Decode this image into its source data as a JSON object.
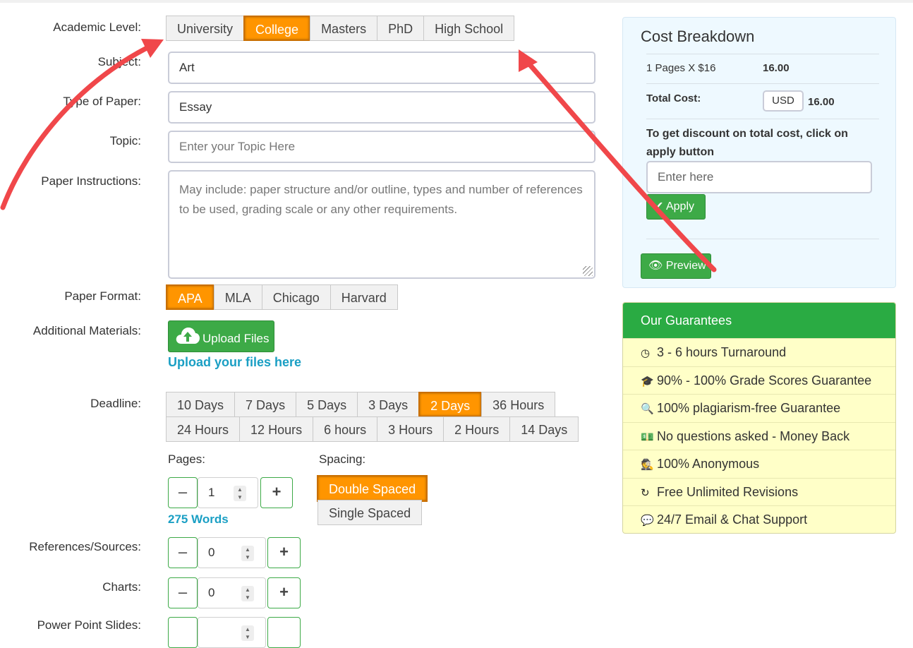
{
  "labels": {
    "academic_level": "Academic Level:",
    "subject": "Subject:",
    "type_of_paper": "Type of Paper:",
    "topic": "Topic:",
    "paper_instructions": "Paper Instructions:",
    "paper_format": "Paper Format:",
    "additional_materials": "Additional Materials:",
    "deadline": "Deadline:",
    "references": "References/Sources:",
    "charts": "Charts:",
    "power_point": "Power Point Slides:"
  },
  "academic_levels": [
    "University",
    "College",
    "Masters",
    "PhD",
    "High School"
  ],
  "academic_level_selected": "College",
  "subject_value": "Art",
  "paper_type_value": "Essay",
  "topic_placeholder": "Enter your Topic Here",
  "instructions_placeholder": "May include: paper structure and/or outline, types and number of references to be used, grading scale or any other requirements.",
  "formats": [
    "APA",
    "MLA",
    "Chicago",
    "Harvard"
  ],
  "format_selected": "APA",
  "upload_label": "Upload Files",
  "upload_link": "Upload your files here",
  "deadlines_row1": [
    "10 Days",
    "7 Days",
    "5 Days",
    "3 Days",
    "2 Days",
    "36 Hours"
  ],
  "deadlines_row2": [
    "24 Hours",
    "12 Hours",
    "6 hours",
    "3 Hours",
    "2 Hours",
    "14 Days"
  ],
  "deadline_selected": "2 Days",
  "pages": {
    "label": "Pages:",
    "value": "1",
    "words": "275 Words"
  },
  "spacing": {
    "label": "Spacing:",
    "options": [
      "Double Spaced",
      "Single Spaced"
    ],
    "selected": "Double Spaced"
  },
  "references_value": "0",
  "charts_value": "0",
  "stepper": {
    "minus": "–",
    "plus": "+"
  },
  "cost": {
    "title": "Cost Breakdown",
    "line": "1 Pages X $16",
    "line_amount": "16.00",
    "total_label": "Total Cost:",
    "currency": "USD",
    "total_amount": "16.00",
    "discount_text": "To get discount on total cost, click on apply button",
    "discount_placeholder": "Enter here",
    "apply_label": "Apply",
    "preview_label": "Preview"
  },
  "guarantees": {
    "title": "Our Guarantees",
    "items": [
      "3 - 6 hours Turnaround",
      "90% - 100% Grade Scores Guarantee",
      "100% plagiarism-free Guarantee",
      "No questions asked - Money Back",
      "100% Anonymous",
      "Free Unlimited Revisions",
      "24/7 Email & Chat Support"
    ],
    "icons": [
      "clock-icon",
      "graduation-cap-icon",
      "search-icon",
      "money-icon",
      "user-secret-icon",
      "refresh-icon",
      "comments-icon"
    ]
  },
  "colors": {
    "accent_orange": "#ff9500",
    "green": "#3daa47",
    "link_blue": "#1a9fc4",
    "annotation_red": "#f0474a"
  }
}
